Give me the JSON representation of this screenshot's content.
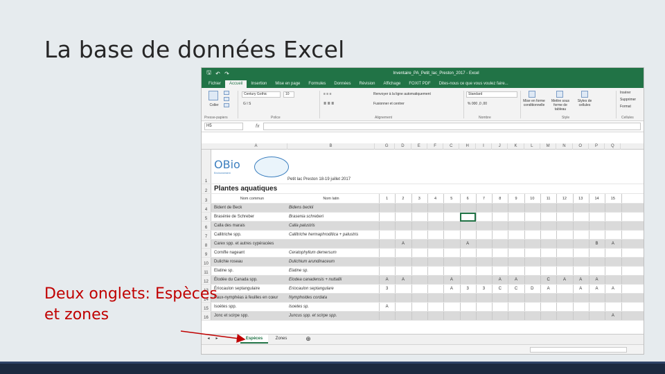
{
  "slide": {
    "title": "La base de données Excel",
    "callout_line1": "Deux onglets: Espèces",
    "callout_line2": "et zones"
  },
  "excel": {
    "window_title": "Inventaire_PA_Petit_lac_Preston_2017 - Excel",
    "quick_access": [
      "save-icon",
      "undo-icon",
      "redo-icon"
    ],
    "menu": [
      "Fichier",
      "Accueil",
      "Insertion",
      "Mise en page",
      "Formules",
      "Données",
      "Révision",
      "Affichage",
      "FOXIT PDF",
      "Dites-nous ce que vous voulez faire..."
    ],
    "active_menu": "Accueil",
    "ribbon": {
      "paste_label": "Coller",
      "font_name": "Century Gothic",
      "font_size": "10",
      "wrap_text": "Renvoyer à la ligne automatiquement",
      "merge_center": "Fusionner et centrer",
      "number_format": "Standard",
      "conditional_format": "Mise en forme conditionnelle",
      "format_table": "Mettre sous forme de tableau",
      "cell_styles": "Styles de cellules",
      "insert": "Insérer",
      "delete": "Supprimer",
      "format": "Format",
      "groups": [
        "Presse-papiers",
        "Police",
        "Alignement",
        "Nombre",
        "Style",
        "Cellules"
      ]
    },
    "name_box": "H5",
    "fx_label": "fx",
    "col_headers": [
      "A",
      "B",
      "G",
      "D",
      "E",
      "F",
      "C",
      "H",
      "I",
      "J",
      "K",
      "L",
      "M",
      "N",
      "O",
      "P",
      "Q"
    ],
    "sheet_header": "Petit lac Preston 18-19 juillet 2017",
    "logo_text": "OBio",
    "logo_sub": "Environnement",
    "section_title": "Plantes aquatiques",
    "table_headers": {
      "common": "Nom commun",
      "latin": "Nom latin"
    },
    "zone_numbers": [
      "1",
      "2",
      "3",
      "4",
      "5",
      "6",
      "7",
      "8",
      "9",
      "10",
      "11",
      "12",
      "13",
      "14",
      "15"
    ],
    "rows": [
      {
        "num": "4",
        "common": "Bident de Beck",
        "latin": "Bidens beckii",
        "marks": [
          "",
          "",
          "",
          "",
          "",
          "",
          "",
          "",
          "",
          "",
          "",
          "",
          "",
          "",
          ""
        ]
      },
      {
        "num": "5",
        "common": "Brasénie de Schreber",
        "latin": "Brasenia schreberi",
        "marks": [
          "",
          "",
          "",
          "",
          "",
          "",
          "",
          "",
          "",
          "",
          "",
          "",
          "",
          "",
          ""
        ]
      },
      {
        "num": "6",
        "common": "Calla des marais",
        "latin": "Calla palustris",
        "marks": [
          "",
          "",
          "",
          "",
          "",
          "",
          "",
          "",
          "",
          "",
          "",
          "",
          "",
          "",
          ""
        ]
      },
      {
        "num": "7",
        "common": "Callitriche spp.",
        "latin": "Callitriche hermaphroditica + palustris",
        "marks": [
          "",
          "",
          "",
          "",
          "",
          "",
          "",
          "",
          "",
          "",
          "",
          "",
          "",
          "",
          ""
        ]
      },
      {
        "num": "8",
        "common": "Carex spp. et autres cypéracées",
        "latin": "",
        "marks": [
          "",
          "A",
          "",
          "",
          "",
          "A",
          "",
          "",
          "",
          "",
          "",
          "",
          "",
          "B",
          "A"
        ]
      },
      {
        "num": "9",
        "common": "Cornifle nageant",
        "latin": "Ceratophyllum demersum",
        "marks": [
          "",
          "",
          "",
          "",
          "",
          "",
          "",
          "",
          "",
          "",
          "",
          "",
          "",
          "",
          ""
        ]
      },
      {
        "num": "10",
        "common": "Dulichie roseau",
        "latin": "Dulichium arundinaceum",
        "marks": [
          "",
          "",
          "",
          "",
          "",
          "",
          "",
          "",
          "",
          "",
          "",
          "",
          "",
          "",
          ""
        ]
      },
      {
        "num": "11",
        "common": "Elatine sp.",
        "latin": "Elatine sp.",
        "marks": [
          "",
          "",
          "",
          "",
          "",
          "",
          "",
          "",
          "",
          "",
          "",
          "",
          "",
          "",
          ""
        ]
      },
      {
        "num": "12",
        "common": "Élodée du Canada spp.",
        "latin": "Elodea canadensis + nuttallii",
        "marks": [
          "A",
          "A",
          "",
          "",
          "A",
          "",
          "",
          "A",
          "A",
          "",
          "C",
          "A",
          "A",
          "A",
          ""
        ]
      },
      {
        "num": "13",
        "common": "Ériocaulon septangulaire",
        "latin": "Eriocaulon septangulare",
        "marks": [
          "3",
          "",
          "",
          "",
          "A",
          "3",
          "3",
          "C",
          "C",
          "D",
          "A",
          "",
          "A",
          "A",
          "A"
        ]
      },
      {
        "num": "14",
        "common": "Faux-nymphéas à feuilles en cœur",
        "latin": "Nymphoides cordata",
        "marks": [
          "",
          "",
          "",
          "",
          "",
          "",
          "",
          "",
          "",
          "",
          "",
          "",
          "",
          "",
          ""
        ]
      },
      {
        "num": "15",
        "common": "Isoètes spp.",
        "latin": "Isoetes sp.",
        "marks": [
          "A",
          "",
          "",
          "",
          "",
          "",
          "",
          "",
          "",
          "",
          "",
          "",
          "",
          "",
          ""
        ]
      },
      {
        "num": "16",
        "common": "Jonc et scirpe spp.",
        "latin": "Juncus spp. et scirpe spp.",
        "marks": [
          "",
          "",
          "",
          "",
          "",
          "",
          "",
          "",
          "",
          "",
          "",
          "",
          "",
          "",
          "A"
        ]
      }
    ],
    "tabs": [
      "Espèces",
      "Zones"
    ],
    "add_sheet": "⊕"
  }
}
